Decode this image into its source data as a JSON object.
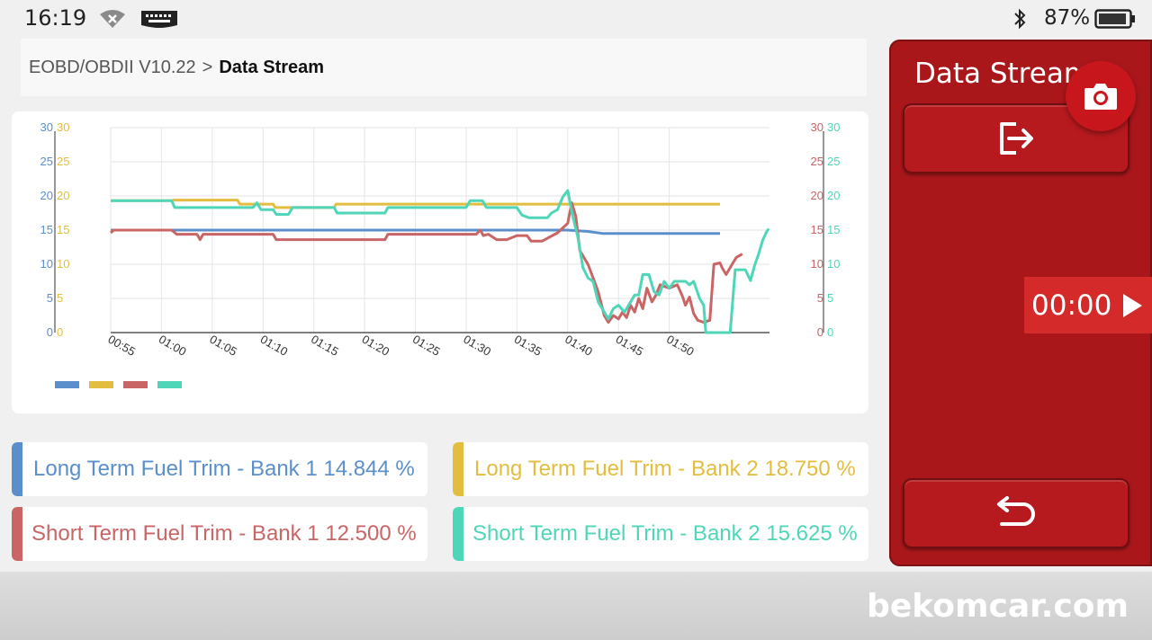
{
  "status_bar": {
    "time": "16:19",
    "battery_percent": "87%"
  },
  "breadcrumb": {
    "root": "EOBD/OBDII V10.22",
    "separator": ">",
    "current": "Data Stream"
  },
  "side_panel": {
    "title": "Data Stream",
    "timer": "00:00"
  },
  "colors": {
    "blue": "#5b8fcb",
    "yellow": "#e2bd3f",
    "red": "#c96565",
    "teal": "#4fd6b8"
  },
  "readouts": [
    {
      "label": "Long Term Fuel Trim - Bank 1 14.844 %",
      "color": "#5b8fcb"
    },
    {
      "label": "Long Term Fuel Trim - Bank 2 18.750 %",
      "color": "#e2bd3f"
    },
    {
      "label": "Short Term Fuel Trim - Bank 1 12.500 %",
      "color": "#c96565"
    },
    {
      "label": "Short Term Fuel Trim - Bank 2 15.625 %",
      "color": "#4fd6b8"
    }
  ],
  "watermark": "bekomcar.com",
  "chart_data": {
    "type": "line",
    "x_ticks": [
      "00:55",
      "01:00",
      "01:05",
      "01:10",
      "01:15",
      "01:20",
      "01:25",
      "01:30",
      "01:35",
      "01:40",
      "01:45",
      "01:50"
    ],
    "xlim": [
      0,
      60
    ],
    "ylim": [
      0,
      30
    ],
    "y_ticks": [
      "0",
      "5",
      "10",
      "15",
      "20",
      "25",
      "30"
    ],
    "grid": true,
    "series": [
      {
        "color": "#5b8fcb",
        "points": [
          [
            0,
            15
          ],
          [
            45,
            15
          ],
          [
            47,
            14.8
          ],
          [
            48.5,
            14.5
          ],
          [
            60,
            14.5
          ]
        ]
      },
      {
        "color": "#e2bd3f",
        "points": [
          [
            0,
            19.3
          ],
          [
            6,
            19.3
          ],
          [
            6.2,
            19.4
          ],
          [
            12.5,
            19.4
          ],
          [
            12.7,
            18.8
          ],
          [
            16,
            18.8
          ],
          [
            16.2,
            18.3
          ],
          [
            19,
            18.3
          ],
          [
            22,
            18.3
          ],
          [
            22.2,
            18.8
          ],
          [
            60,
            18.8
          ]
        ]
      },
      {
        "color": "#c96565",
        "points": [
          [
            0,
            14.6
          ],
          [
            0.3,
            15
          ],
          [
            6,
            15
          ],
          [
            6.5,
            14.4
          ],
          [
            8.5,
            14.4
          ],
          [
            8.8,
            13.6
          ],
          [
            9.1,
            14.4
          ],
          [
            16,
            14.4
          ],
          [
            16.3,
            13.6
          ],
          [
            27,
            13.6
          ],
          [
            27.3,
            14.4
          ],
          [
            36,
            14.4
          ],
          [
            36.4,
            15
          ],
          [
            36.7,
            14.2
          ],
          [
            37.2,
            14.4
          ],
          [
            37.6,
            14
          ],
          [
            38,
            13.6
          ],
          [
            39,
            13.6
          ],
          [
            40,
            14.2
          ],
          [
            41,
            14.2
          ],
          [
            41.4,
            13.4
          ],
          [
            42.5,
            13.4
          ],
          [
            43,
            13.8
          ],
          [
            44,
            14.6
          ],
          [
            45,
            16
          ],
          [
            45.4,
            19
          ],
          [
            45.8,
            17
          ],
          [
            46.2,
            12
          ],
          [
            47,
            10
          ],
          [
            47.5,
            8
          ],
          [
            48,
            6
          ],
          [
            48.6,
            2.5
          ],
          [
            49,
            1.5
          ],
          [
            49.5,
            2.5
          ],
          [
            50,
            2
          ],
          [
            50.4,
            3
          ],
          [
            50.8,
            2.2
          ],
          [
            51.2,
            4
          ],
          [
            51.6,
            3
          ],
          [
            52,
            5
          ],
          [
            52.4,
            3.5
          ],
          [
            52.8,
            6.5
          ],
          [
            53.3,
            4.5
          ],
          [
            53.7,
            5.5
          ],
          [
            54.1,
            7
          ],
          [
            55,
            6.5
          ],
          [
            55.8,
            7
          ],
          [
            56.3,
            5.3
          ],
          [
            56.6,
            4
          ],
          [
            57,
            5.2
          ],
          [
            57.4,
            2.8
          ],
          [
            57.8,
            1.8
          ],
          [
            58.4,
            1.5
          ],
          [
            59,
            1.8
          ],
          [
            59.4,
            10
          ],
          [
            60,
            10.2
          ],
          [
            60.2,
            9.5
          ],
          [
            60.6,
            8.5
          ],
          [
            61.2,
            10
          ],
          [
            61.6,
            11
          ],
          [
            62.2,
            11.5
          ]
        ]
      },
      {
        "color": "#4fd6b8",
        "points": [
          [
            0,
            19.3
          ],
          [
            6,
            19.3
          ],
          [
            6.3,
            18.3
          ],
          [
            14,
            18.3
          ],
          [
            14.4,
            19
          ],
          [
            14.8,
            18
          ],
          [
            16,
            18
          ],
          [
            16.3,
            17.3
          ],
          [
            17.5,
            17.3
          ],
          [
            17.9,
            18.3
          ],
          [
            20,
            18.3
          ],
          [
            22,
            18.3
          ],
          [
            22.3,
            17.5
          ],
          [
            27,
            17.5
          ],
          [
            27.3,
            18.3
          ],
          [
            35,
            18.3
          ],
          [
            35.4,
            19.3
          ],
          [
            36.6,
            19.3
          ],
          [
            37,
            18.3
          ],
          [
            40,
            18.3
          ],
          [
            40.5,
            17.2
          ],
          [
            41.2,
            16.8
          ],
          [
            42,
            16.8
          ],
          [
            43,
            16.8
          ],
          [
            43.4,
            17.5
          ],
          [
            44,
            18
          ],
          [
            44.5,
            19.8
          ],
          [
            45,
            20.8
          ],
          [
            45.5,
            17
          ],
          [
            46,
            14
          ],
          [
            46.5,
            9.5
          ],
          [
            47,
            8
          ],
          [
            47.5,
            7.5
          ],
          [
            48,
            4.5
          ],
          [
            48.6,
            3
          ],
          [
            49,
            2
          ],
          [
            49.5,
            3.5
          ],
          [
            50,
            4
          ],
          [
            50.6,
            3
          ],
          [
            51.2,
            4.5
          ],
          [
            51.6,
            5.5
          ],
          [
            52,
            5.5
          ],
          [
            52.4,
            8.5
          ],
          [
            53,
            8.5
          ],
          [
            53.5,
            6
          ],
          [
            54,
            5.5
          ],
          [
            54.5,
            7.5
          ],
          [
            55,
            6.5
          ],
          [
            55.5,
            7.5
          ],
          [
            56.6,
            7.5
          ],
          [
            57,
            7
          ],
          [
            57.4,
            7.5
          ],
          [
            58,
            5
          ],
          [
            58.4,
            4
          ],
          [
            58.6,
            0
          ],
          [
            59.5,
            0
          ],
          [
            60.2,
            0
          ],
          [
            61,
            0
          ],
          [
            61.5,
            9.2
          ],
          [
            62,
            9.2
          ],
          [
            62.5,
            9.2
          ],
          [
            63,
            7.6
          ],
          [
            63.4,
            9.8
          ],
          [
            63.8,
            11.5
          ],
          [
            64.2,
            13.5
          ],
          [
            64.6,
            14.8
          ],
          [
            64.8,
            15.2
          ]
        ]
      }
    ]
  }
}
